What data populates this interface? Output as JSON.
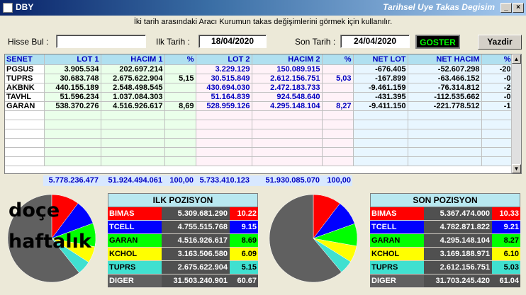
{
  "window": {
    "app_title": "DBY",
    "title": "Tarihsel Uye Takas Degisim"
  },
  "info_text": "İki tarih arasındaki  Aracı Kurumun takas değişimlerini görmek için kullanılır.",
  "filters": {
    "hisse_label": "Hisse Bul :",
    "hisse_value": "",
    "ilk_label": "Ilk Tarih :",
    "ilk_value": "18/04/2020",
    "son_label": "Son Tarih :",
    "son_value": "24/04/2020",
    "goster_label": "GOSTER",
    "yazdir_label": "Yazdir"
  },
  "grid": {
    "headers": [
      "SENET",
      "LOT 1",
      "HACIM 1",
      "%",
      "LOT 2",
      "HACIM 2",
      "%",
      "NET LOT",
      "NET HACIM",
      "%"
    ],
    "rows": [
      [
        "PGSUS",
        "3.905.534",
        "202.697.214",
        "",
        "3.229.129",
        "150.089.915",
        "",
        "-676.405",
        "-52.607.298",
        "-20"
      ],
      [
        "TUPRS",
        "30.683.748",
        "2.675.622.904",
        "5,15",
        "30.515.849",
        "2.612.156.751",
        "5,03",
        "-167.899",
        "-63.466.152",
        "-0"
      ],
      [
        "AKBNK",
        "440.155.189",
        "2.548.498.545",
        "",
        "430.694.030",
        "2.472.183.733",
        "",
        "-9.461.159",
        "-76.314.812",
        "-2"
      ],
      [
        "TAVHL",
        "51.596.234",
        "1.037.084.303",
        "",
        "51.164.839",
        "924.548.640",
        "",
        "-431.395",
        "-112.535.662",
        "-0"
      ],
      [
        "GARAN",
        "538.370.276",
        "4.516.926.617",
        "8,69",
        "528.959.126",
        "4.295.148.104",
        "8,27",
        "-9.411.150",
        "-221.778.512",
        "-1"
      ]
    ],
    "totals": [
      "5.778.236.477",
      "51.924.494.061",
      "100,00",
      "5.733.410.123",
      "51.930.085.070",
      "100,00"
    ]
  },
  "overlay": {
    "line1": "doçe",
    "line2": "haftalık"
  },
  "ilk_pozisyon": {
    "title": "ILK POZISYON",
    "rows": [
      {
        "name": "BIMAS",
        "value": "5.309.681.290",
        "pct": "10.22",
        "color": "#ff0000",
        "text": "#ffffff"
      },
      {
        "name": "TCELL",
        "value": "4.755.515.768",
        "pct": "9.15",
        "color": "#0000ff",
        "text": "#ffffff"
      },
      {
        "name": "GARAN",
        "value": "4.516.926.617",
        "pct": "8.69",
        "color": "#00ff00",
        "text": "#000000"
      },
      {
        "name": "KCHOL",
        "value": "3.163.506.580",
        "pct": "6.09",
        "color": "#ffff00",
        "text": "#000000"
      },
      {
        "name": "TUPRS",
        "value": "2.675.622.904",
        "pct": "5.15",
        "color": "#40e0d0",
        "text": "#000000"
      },
      {
        "name": "DIGER",
        "value": "31.503.240.901",
        "pct": "60.67",
        "color": "#606060",
        "text": "#ffffff"
      }
    ]
  },
  "son_pozisyon": {
    "title": "SON POZISYON",
    "rows": [
      {
        "name": "BIMAS",
        "value": "5.367.474.000",
        "pct": "10.33",
        "color": "#ff0000",
        "text": "#ffffff"
      },
      {
        "name": "TCELL",
        "value": "4.782.871.822",
        "pct": "9.21",
        "color": "#0000ff",
        "text": "#ffffff"
      },
      {
        "name": "GARAN",
        "value": "4.295.148.104",
        "pct": "8.27",
        "color": "#00ff00",
        "text": "#000000"
      },
      {
        "name": "KCHOL",
        "value": "3.169.188.971",
        "pct": "6.10",
        "color": "#ffff00",
        "text": "#000000"
      },
      {
        "name": "TUPRS",
        "value": "2.612.156.751",
        "pct": "5.03",
        "color": "#40e0d0",
        "text": "#000000"
      },
      {
        "name": "DIGER",
        "value": "31.703.245.420",
        "pct": "61.04",
        "color": "#606060",
        "text": "#ffffff"
      }
    ]
  }
}
